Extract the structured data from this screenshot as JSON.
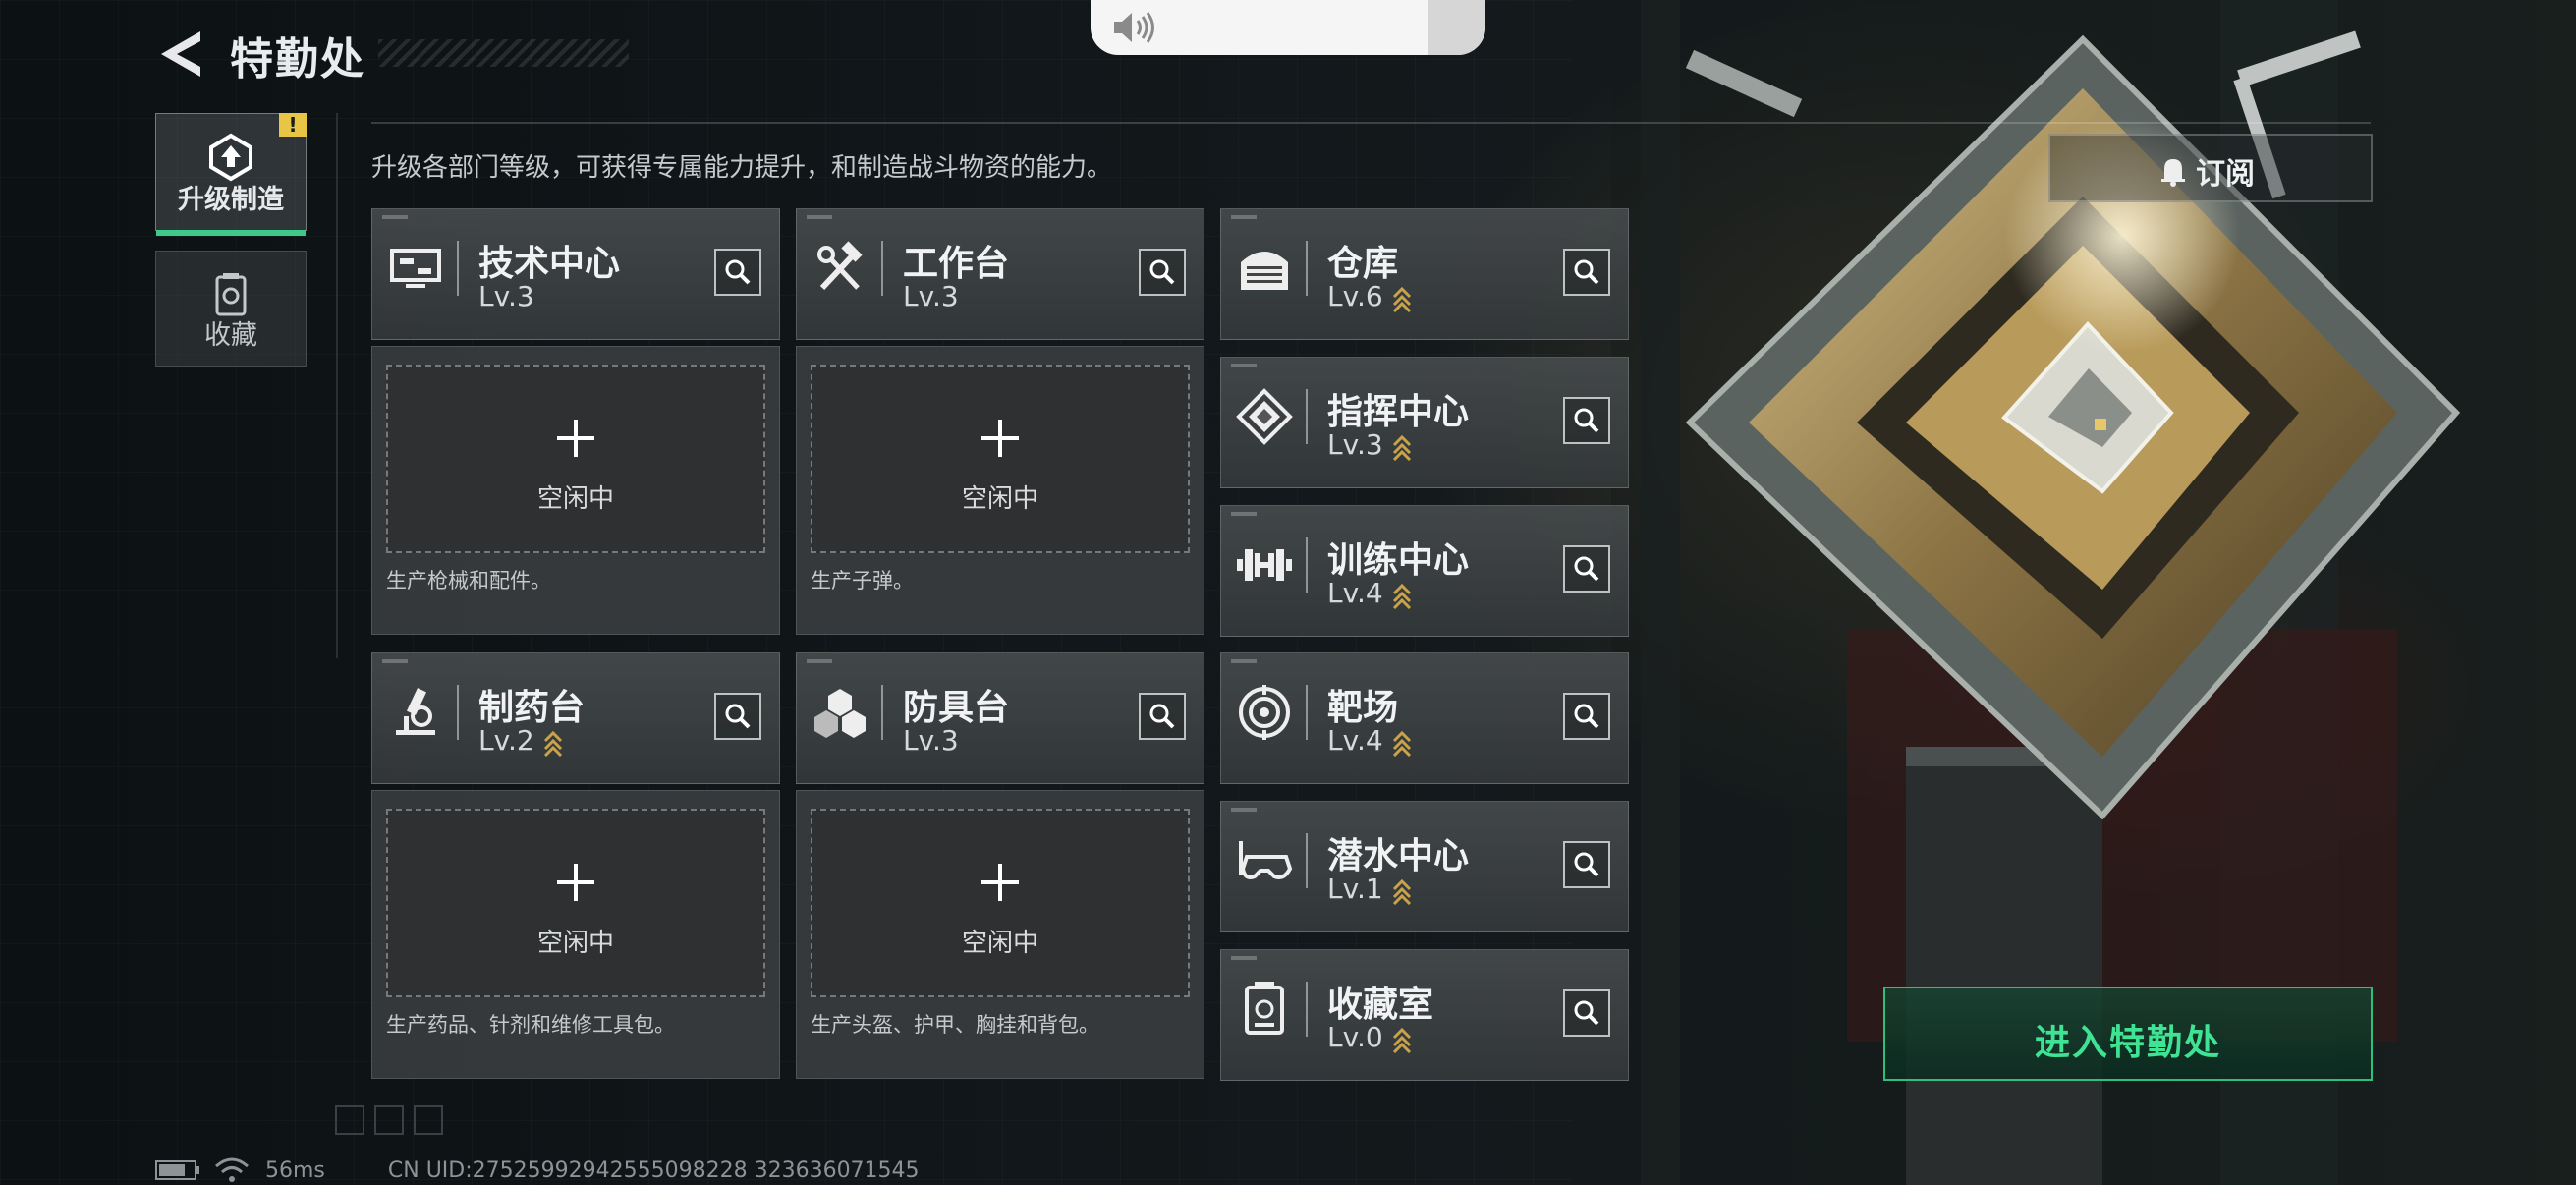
{
  "header": {
    "title": "特勤处",
    "subtitle": "升级各部门等级，可获得专属能力提升，和制造战斗物资的能力。"
  },
  "side_tabs": [
    {
      "label": "升级制造",
      "badge": "!",
      "active": true
    },
    {
      "label": "收藏",
      "active": false
    }
  ],
  "production_cards": [
    {
      "name": "技术中心",
      "level": "Lv.3",
      "idle": "空闲中",
      "description": "生产枪械和配件。",
      "upgradable": false
    },
    {
      "name": "工作台",
      "level": "Lv.3",
      "idle": "空闲中",
      "description": "生产子弹。",
      "upgradable": false
    },
    {
      "name": "制药台",
      "level": "Lv.2",
      "idle": "空闲中",
      "description": "生产药品、针剂和维修工具包。",
      "upgradable": true
    },
    {
      "name": "防具台",
      "level": "Lv.3",
      "idle": "空闲中",
      "description": "生产头盔、护甲、胸挂和背包。",
      "upgradable": false
    }
  ],
  "facility_cards": [
    {
      "name": "仓库",
      "level": "Lv.6",
      "icon": "warehouse-icon",
      "upgradable": true
    },
    {
      "name": "指挥中心",
      "level": "Lv.3",
      "icon": "chip-icon",
      "upgradable": true
    },
    {
      "name": "训练中心",
      "level": "Lv.4",
      "icon": "dumbbell-icon",
      "upgradable": true
    },
    {
      "name": "靶场",
      "level": "Lv.4",
      "icon": "target-icon",
      "upgradable": true
    },
    {
      "name": "潜水中心",
      "level": "Lv.1",
      "icon": "diving-mask-icon",
      "upgradable": true
    },
    {
      "name": "收藏室",
      "level": "Lv.0",
      "icon": "collection-icon",
      "upgradable": true
    }
  ],
  "actions": {
    "subscribe_label": "订阅",
    "enter_label": "进入特勤处"
  },
  "status": {
    "ping": "56ms",
    "uid": "CN UID:27525992942555098228 323636071545"
  },
  "colors": {
    "accent_green": "#3fe394",
    "tab_underline": "#3ec98b",
    "upgrade_gold": "#c9a24a",
    "badge_yellow": "#e9c545"
  }
}
